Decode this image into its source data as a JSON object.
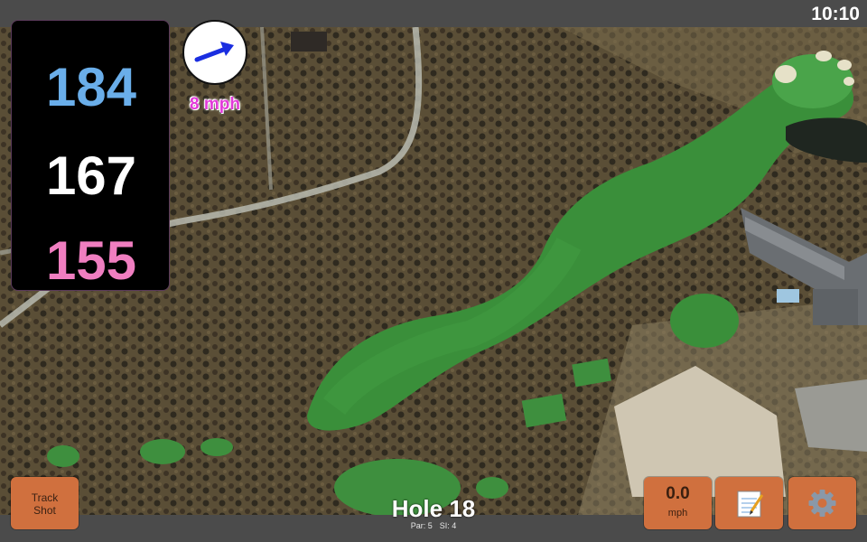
{
  "status_bar": {
    "time": "10:10"
  },
  "distances": {
    "back": "184",
    "middle": "167",
    "front": "155"
  },
  "wind": {
    "speed_label": "8 mph",
    "direction_icon": "arrow-icon",
    "arrow_color": "#1a2ee0"
  },
  "buttons": {
    "track_shot_line1": "Track",
    "track_shot_line2": "Shot",
    "speed_value": "0.0",
    "speed_unit": "mph",
    "notes_icon": "notepad-icon",
    "settings_icon": "gear-icon"
  },
  "hole": {
    "title": "Hole 18",
    "par_label": "Par: 5",
    "si_label": "SI: 4"
  },
  "colors": {
    "back_distance": "#6aaeea",
    "middle_distance": "#ffffff",
    "front_distance": "#f07ec0",
    "button": "#d0703e",
    "wind_text": "#e23ad9"
  }
}
